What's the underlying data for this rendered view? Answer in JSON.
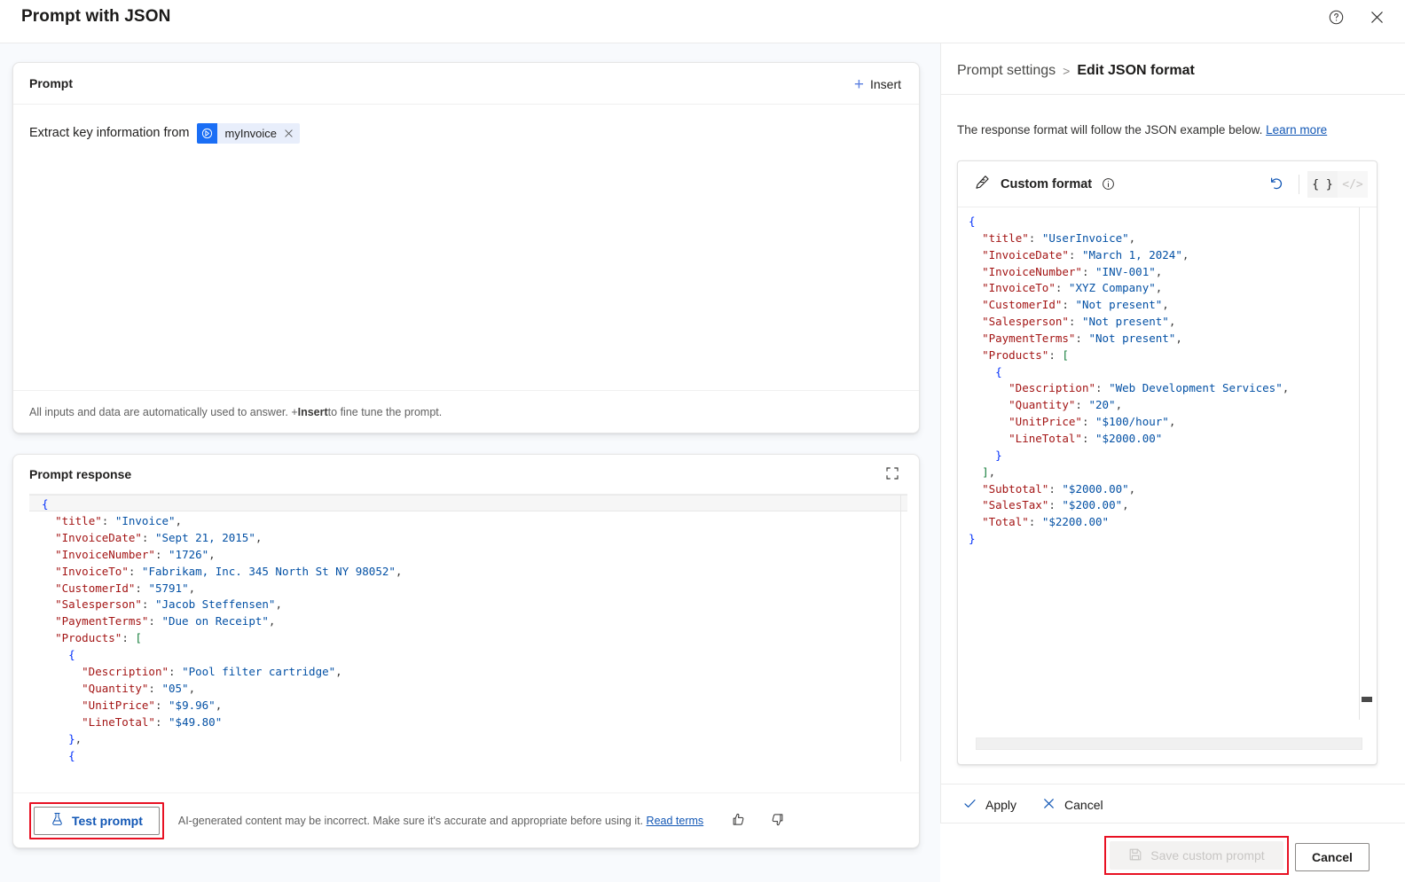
{
  "dialog": {
    "title": "Prompt with JSON",
    "help_icon": "help-circle-icon",
    "close_icon": "close-icon"
  },
  "prompt_card": {
    "title": "Prompt",
    "insert_label": "Insert",
    "prompt_text": "Extract key information from",
    "chip_label": "myInvoice",
    "footer_prefix": "All inputs and data are automatically used to answer. + ",
    "footer_bold": "Insert",
    "footer_suffix": " to fine tune the prompt."
  },
  "response_card": {
    "title": "Prompt response",
    "expand_icon": "expand-icon",
    "code": "{\n  \"title\": \"Invoice\",\n  \"InvoiceDate\": \"Sept 21, 2015\",\n  \"InvoiceNumber\": \"1726\",\n  \"InvoiceTo\": \"Fabrikam, Inc. 345 North St NY 98052\",\n  \"CustomerId\": \"5791\",\n  \"Salesperson\": \"Jacob Steffensen\",\n  \"PaymentTerms\": \"Due on Receipt\",\n  \"Products\": [\n    {\n      \"Description\": \"Pool filter cartridge\",\n      \"Quantity\": \"05\",\n      \"UnitPrice\": \"$9.96\",\n      \"LineTotal\": \"$49.80\"\n    },\n    {",
    "test_prompt_label": "Test prompt",
    "disclaimer": "AI-generated content may be incorrect. Make sure it's accurate and appropriate before using it. ",
    "read_terms_label": "Read terms",
    "thumbs_up_icon": "thumbs-up-icon",
    "thumbs_down_icon": "thumbs-down-icon"
  },
  "settings_panel": {
    "breadcrumb_parent": "Prompt settings",
    "breadcrumb_separator": ">",
    "breadcrumb_current": "Edit JSON format",
    "description": "The response format will follow the JSON example below. ",
    "learn_more_label": "Learn more",
    "format_title": "Custom format",
    "info_icon": "info-circle-icon",
    "reset_icon": "undo-arrow-icon",
    "braces_label": "{ }",
    "code_label": "</>",
    "format_code": "{\n  \"title\": \"UserInvoice\",\n  \"InvoiceDate\": \"March 1, 2024\",\n  \"InvoiceNumber\": \"INV-001\",\n  \"InvoiceTo\": \"XYZ Company\",\n  \"CustomerId\": \"Not present\",\n  \"Salesperson\": \"Not present\",\n  \"PaymentTerms\": \"Not present\",\n  \"Products\": [\n    {\n      \"Description\": \"Web Development Services\",\n      \"Quantity\": \"20\",\n      \"UnitPrice\": \"$100/hour\",\n      \"LineTotal\": \"$2000.00\"\n    }\n  ],\n  \"Subtotal\": \"$2000.00\",\n  \"SalesTax\": \"$200.00\",\n  \"Total\": \"$2200.00\"\n}",
    "apply_label": "Apply",
    "cancel_label": "Cancel"
  },
  "bottom_bar": {
    "save_label": "Save custom prompt",
    "save_icon": "save-disk-icon",
    "cancel_label": "Cancel"
  },
  "colors": {
    "accent": "#1257b5",
    "chip_icon_bg": "#1a6ef5",
    "highlight_red": "#e81123",
    "json_key": "#a31515",
    "json_string": "#0451a5",
    "json_brace": "#0431fa"
  }
}
